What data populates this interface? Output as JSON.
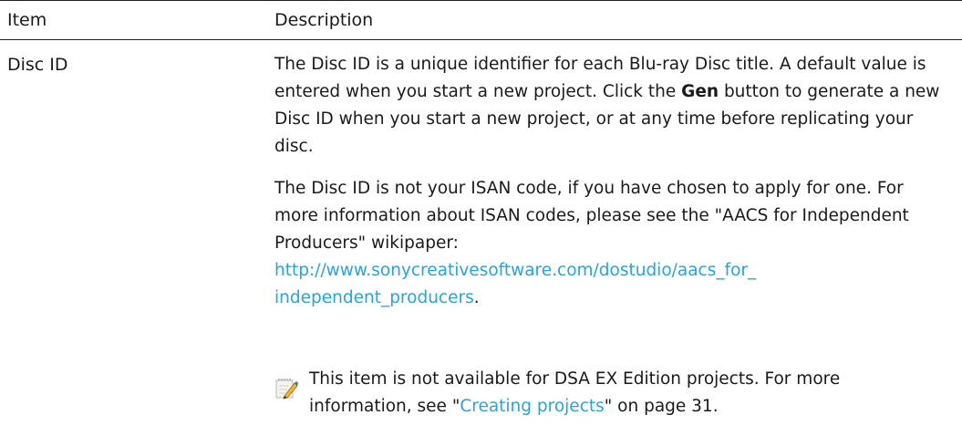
{
  "table": {
    "headers": {
      "item": "Item",
      "description": "Description"
    },
    "row": {
      "label": "Disc ID",
      "para1": {
        "part1": "The Disc ID is a unique identifier for each Blu-ray Disc title. A default value is entered when you start a new project. Click the ",
        "bold": "Gen",
        "part2": " button to generate a new Disc ID when you start a new project, or at any time before replicating your disc."
      },
      "para2": {
        "text": "The Disc ID is not your ISAN code, if you have chosen to apply for one. For more information about ISAN codes, please see the \"AACS for Independent Producers\" wikipaper: ",
        "link_line1": "http://www.sonycreativesoftware.com/dostudio/aacs_for_",
        "link_line2": "independent_producers",
        "end": "."
      },
      "note": {
        "icon": "note-pencil-icon",
        "part1": "This item is not available for DSA EX Edition projects. For more information, see \"",
        "link": "Creating projects",
        "part2": "\" on page 31."
      }
    }
  },
  "colors": {
    "link": "#2aa3d6",
    "text": "#1a1a1a",
    "rule": "#222222"
  }
}
